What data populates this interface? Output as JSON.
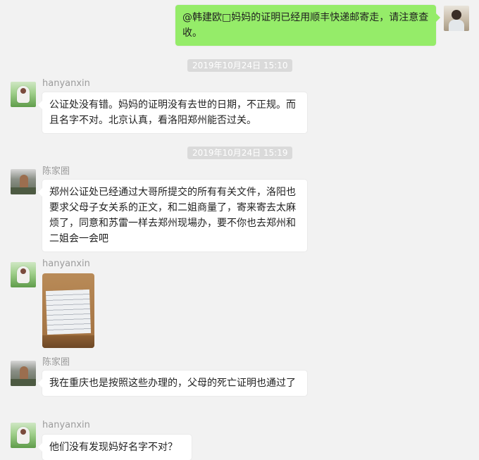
{
  "chat": {
    "messages": [
      {
        "type": "self",
        "text": "@韩建欧□妈妈的证明已经用顺丰快递邮寄走，请注意查收。"
      },
      {
        "type": "time",
        "text": "2019年10月24日 15:10"
      },
      {
        "type": "other",
        "sender": "hanyanxin",
        "text": "公证处没有错。妈妈的证明没有去世的日期，不正规。而且名字不对。北京认真，看洛阳郑州能否过关。"
      },
      {
        "type": "time",
        "text": "2019年10月24日 15:19"
      },
      {
        "type": "other",
        "sender": "陈家圈",
        "text": "郑州公证处已经通过大哥所提交的所有有关文件，洛阳也要求父母子女关系的正文，和二姐商量了，寄来寄去太麻烦了，同意和苏雷一样去郑州现場办，要不你也去郑州和二姐会一会吧"
      },
      {
        "type": "other-image",
        "sender": "hanyanxin"
      },
      {
        "type": "other",
        "sender": "陈家圈",
        "text": "我在重庆也是按照这些办理的，父母的死亡证明也通过了"
      },
      {
        "type": "other",
        "sender": "hanyanxin",
        "text": "他们没有发现妈好名字不对？"
      }
    ]
  }
}
